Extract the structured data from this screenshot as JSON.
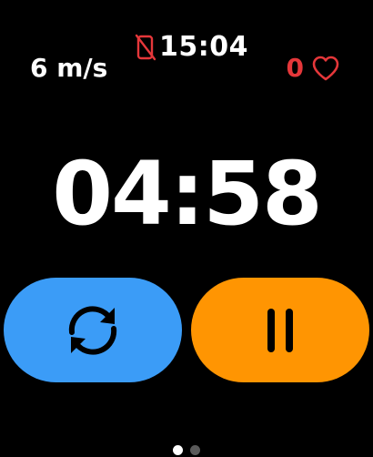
{
  "status": {
    "clock": "15:04",
    "phone_icon": "phone-disconnected-icon",
    "speed": "6 m/s",
    "heart_rate": "0",
    "heart_icon": "heart-outline-icon"
  },
  "timer": {
    "remaining": "04:58"
  },
  "controls": {
    "repeat_icon": "repeat-icon",
    "pause_icon": "pause-icon"
  },
  "pages": {
    "current": 1,
    "total": 2
  },
  "colors": {
    "background": "#000000",
    "repeat_button": "#3b9cf7",
    "pause_button": "#ff9502",
    "alert_red": "#e5373a"
  }
}
